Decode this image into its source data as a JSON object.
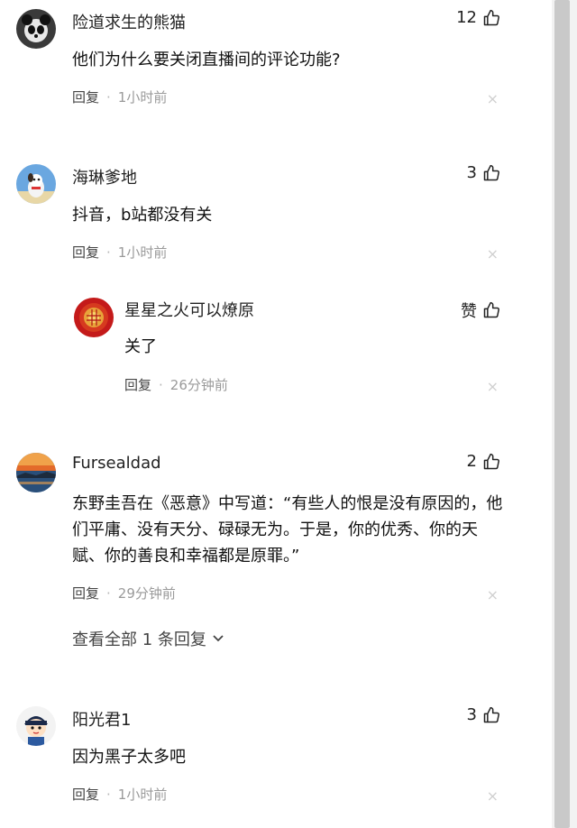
{
  "comments": [
    {
      "username": "险道求生的熊猫",
      "likes": "12",
      "content": "他们为什么要关闭直播间的评论功能?",
      "reply_label": "回复",
      "separator": "·",
      "time": "1小时前",
      "avatar_icon": "panda-avatar"
    },
    {
      "username": "海琳爹地",
      "likes": "3",
      "content": "抖音，b站都没有关",
      "reply_label": "回复",
      "separator": "·",
      "time": "1小时前",
      "avatar_icon": "cartoon-dog-avatar",
      "replies": [
        {
          "username": "星星之火可以燎原",
          "likes": "赞",
          "content": "关了",
          "reply_label": "回复",
          "separator": "·",
          "time": "26分钟前",
          "avatar_icon": "red-seal-avatar"
        }
      ]
    },
    {
      "username": "Fursealdad",
      "likes": "2",
      "content": "东野圭吾在《恶意》中写道：“有些人的恨是没有原因的，他们平庸、没有天分、碌碌无为。于是，你的优秀、你的天赋、你的善良和幸福都是原罪。”",
      "reply_label": "回复",
      "separator": "·",
      "time": "29分钟前",
      "avatar_icon": "sunset-lake-avatar",
      "view_all_replies": "查看全部 1 条回复"
    },
    {
      "username": "阳光君1",
      "likes": "3",
      "content": "因为黑子太多吧",
      "reply_label": "回复",
      "separator": "·",
      "time": "1小时前",
      "avatar_icon": "cartoon-boy-avatar"
    }
  ],
  "close_glyph": "×"
}
